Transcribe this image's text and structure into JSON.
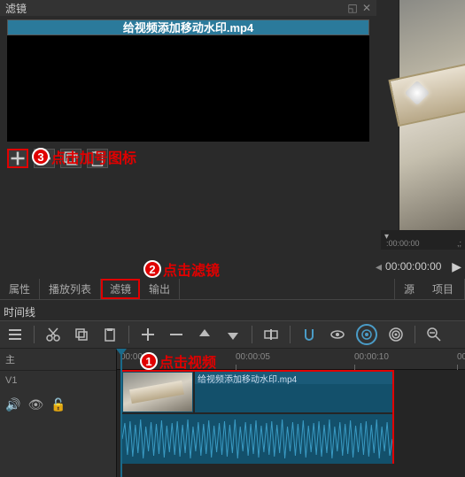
{
  "panel": {
    "title": "滤镜"
  },
  "file": {
    "title": "给视频添加移动水印.mp4"
  },
  "toolbar": {
    "add": "+",
    "remove": "−"
  },
  "annotations": {
    "a1": {
      "num": "1",
      "text": "点击视频"
    },
    "a2": {
      "num": "2",
      "text": "点击滤镜"
    },
    "a3": {
      "num": "3",
      "text": "点击加号图标"
    }
  },
  "scrubber": {
    "start": ":00:00:00",
    "sep": ",;"
  },
  "timecode": {
    "value": "00:00:00:00"
  },
  "tabs": {
    "t1": "属性",
    "t2": "播放列表",
    "t3": "滤镜",
    "t4": "输出",
    "t5": "源",
    "t6": "项目"
  },
  "timeline_label": "时间线",
  "track": {
    "master": "主",
    "v1": "V1"
  },
  "ruler": {
    "r0": "00:00:00",
    "r1": "00:00:05",
    "r2": "00:00:10",
    "r3": "00"
  },
  "clip": {
    "label": "给视频添加移动水印.mp4"
  }
}
